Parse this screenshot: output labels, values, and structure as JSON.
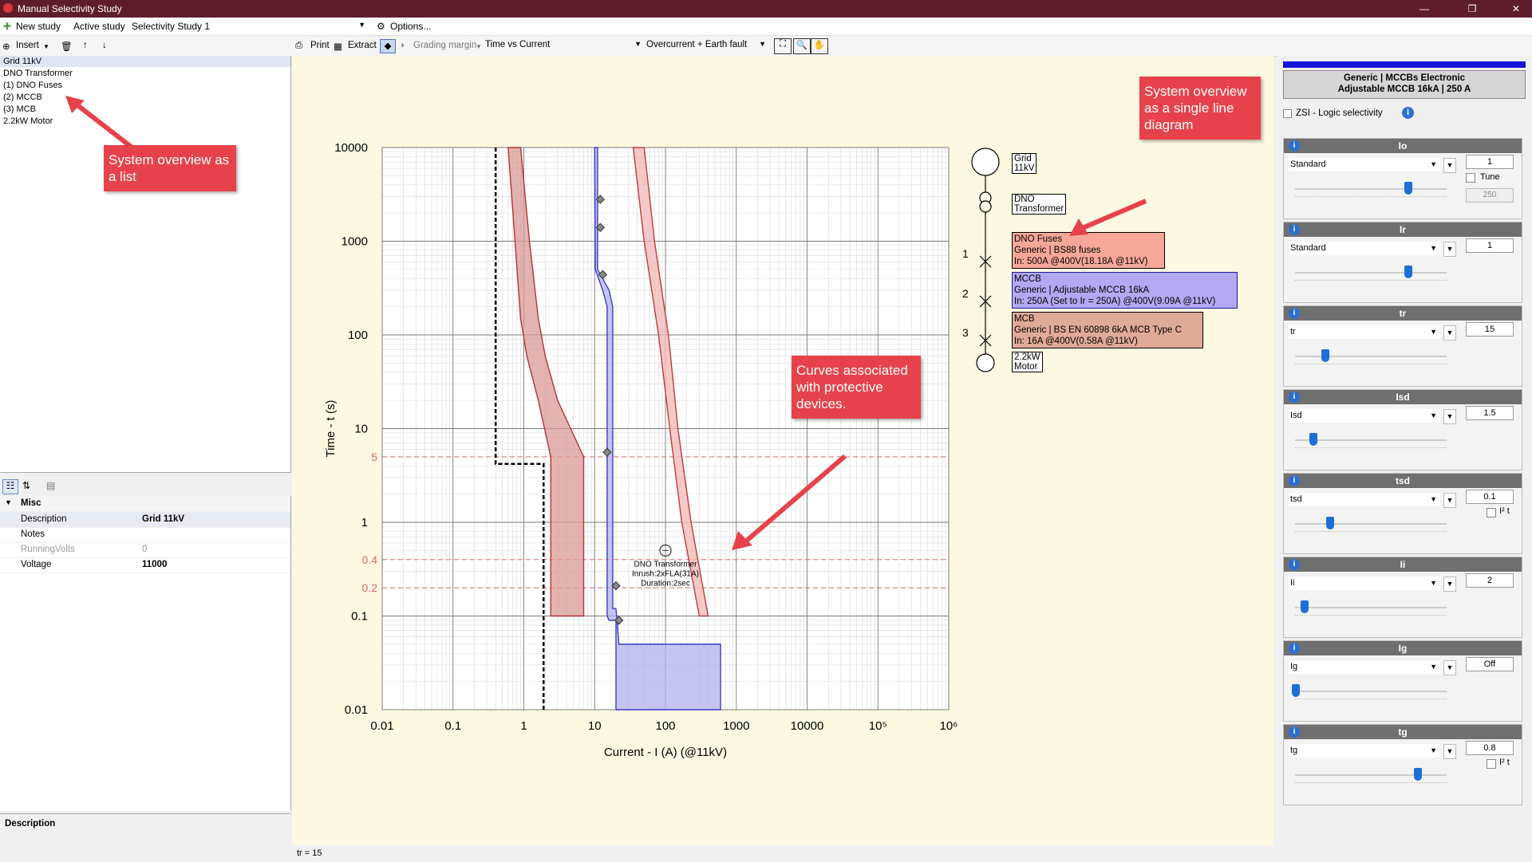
{
  "window": {
    "title": "Manual Selectivity Study",
    "minimize": "—",
    "maximize": "❐",
    "close": "✕"
  },
  "studybar": {
    "new_study": "New study",
    "active_study_label": "Active study",
    "active_study_value": "Selectivity Study 1",
    "options": "Options..."
  },
  "toolbar": {
    "insert": "Insert",
    "print": "Print",
    "extract": "Extract",
    "grading_margin": "Grading margin",
    "view_mode": "Time vs Current",
    "fault_mode": "Overcurrent + Earth fault"
  },
  "tree": {
    "items": [
      "Grid 11kV",
      "DNO Transformer",
      "(1) DNO Fuses",
      "(2) MCCB",
      "(3) MCB",
      "2.2kW Motor"
    ]
  },
  "properties": {
    "category": "Misc",
    "rows": [
      {
        "key": "Description",
        "value": "Grid 11kV",
        "bold": true
      },
      {
        "key": "Notes",
        "value": "",
        "bold": false
      },
      {
        "key": "RunningVolts",
        "value": "0",
        "bold": false,
        "grey": true
      },
      {
        "key": "Voltage",
        "value": "11000",
        "bold": true
      }
    ]
  },
  "description_panel": {
    "title": "Description"
  },
  "status": {
    "text": "tr = 15"
  },
  "callouts": {
    "list": "System overview as a list",
    "sld": "System overview as a single line diagram",
    "curves": "Curves associated with protective devices."
  },
  "sld": {
    "grid": "Grid 11kV",
    "transformer": "DNO Transformer",
    "motor": "2.2kW Motor",
    "devices": [
      {
        "num": "1",
        "lines": [
          "DNO Fuses",
          "Generic | BS88 fuses",
          "In: 500A @400V(18.18A @11kV)"
        ],
        "color": "#f6a799"
      },
      {
        "num": "2",
        "lines": [
          "MCCB",
          "Generic | Adjustable MCCB 16kA",
          "In: 250A (Set to Ir = 250A) @400V(9.09A @11kV)"
        ],
        "color": "#b3a8f2"
      },
      {
        "num": "3",
        "lines": [
          "MCB",
          "Generic | BS EN 60898 6kA MCB Type C",
          "In: 16A @400V(0.58A @11kV)"
        ],
        "color": "#e0aa98"
      }
    ]
  },
  "right_panel": {
    "device_title_1": "Generic | MCCBs Electronic",
    "device_title_2": "Adjustable MCCB 16kA | 250 A",
    "zsi": "ZSI - Logic selectivity",
    "sections": [
      {
        "name": "Io",
        "mode": "Standard",
        "value": "1",
        "pos": 0.76,
        "extra": "tune"
      },
      {
        "name": "Ir",
        "mode": "Standard",
        "value": "1",
        "pos": 0.76
      },
      {
        "name": "tr",
        "mode": "tr",
        "value": "15",
        "pos": 0.2
      },
      {
        "name": "Isd",
        "mode": "Isd",
        "value": "1.5",
        "pos": 0.12
      },
      {
        "name": "tsd",
        "mode": "tsd",
        "value": "0.1",
        "pos": 0.23,
        "extra": "i2t"
      },
      {
        "name": "Ii",
        "mode": "Ii",
        "value": "2",
        "pos": 0.06
      },
      {
        "name": "Ig",
        "mode": "Ig",
        "value": "Off",
        "pos": 0.0
      },
      {
        "name": "tg",
        "mode": "tg",
        "value": "0.8",
        "pos": 0.82,
        "extra": "i2t"
      }
    ],
    "tune_label": "Tune",
    "tune_value": "250",
    "i2t_label": "I² t"
  },
  "chart_data": {
    "type": "line",
    "xlabel": "Current - I (A)   (@11kV)",
    "ylabel": "Time - t (s)",
    "xscale": "log",
    "yscale": "log",
    "xlim": [
      0.01,
      1000000
    ],
    "ylim": [
      0.01,
      10000
    ],
    "x_ticks": [
      "0.01",
      "0.1",
      "1",
      "10",
      "100",
      "1000",
      "10000",
      "10⁵",
      "10⁶"
    ],
    "y_ticks": [
      "10000",
      "1000",
      "100",
      "10",
      "1",
      "0.1",
      "0.01"
    ],
    "margin_lines": [
      {
        "y": 5,
        "label": "5"
      },
      {
        "y": 0.4,
        "label": "0.4"
      },
      {
        "y": 0.2,
        "label": "0.2"
      }
    ],
    "grid": true,
    "annotation": {
      "x": 100,
      "y": 0.5,
      "lines": [
        "DNO Transformer",
        "Inrush:2xFLA(31A)",
        "Duration:2sec"
      ]
    },
    "series": [
      {
        "name": "DNO Fuses",
        "color": "#b53434",
        "fill": "#d89a96",
        "left": [
          [
            0.6,
            10000
          ],
          [
            0.75,
            1000
          ],
          [
            0.9,
            150
          ],
          [
            1.1,
            60
          ],
          [
            1.6,
            20
          ],
          [
            2.4,
            5
          ],
          [
            2.4,
            0.1
          ]
        ],
        "right": [
          [
            0.9,
            10000
          ],
          [
            1.2,
            1000
          ],
          [
            1.6,
            150
          ],
          [
            2.0,
            60
          ],
          [
            3.0,
            20
          ],
          [
            7.0,
            5
          ],
          [
            7.0,
            0.1
          ]
        ]
      },
      {
        "name": "MCCB",
        "color": "#3a3ad0",
        "fill": "#b2b2ee",
        "left": [
          [
            10,
            10000
          ],
          [
            10.2,
            500
          ],
          [
            13,
            300
          ],
          [
            15,
            200
          ],
          [
            15,
            0.1
          ],
          [
            16,
            0.09
          ],
          [
            20,
            0.09
          ],
          [
            20,
            0.01
          ]
        ],
        "right": [
          [
            11,
            10000
          ],
          [
            11,
            500
          ],
          [
            16,
            300
          ],
          [
            18,
            200
          ],
          [
            18,
            0.12
          ],
          [
            20,
            0.12
          ],
          [
            21,
            0.08
          ],
          [
            22,
            0.05
          ],
          [
            600,
            0.05
          ],
          [
            600,
            0.01
          ]
        ]
      },
      {
        "name": "MCB",
        "color": "#c03a3a",
        "fill": "#f2b7b7",
        "left": [
          [
            35,
            10000
          ],
          [
            50,
            1000
          ],
          [
            80,
            100
          ],
          [
            115,
            10
          ],
          [
            170,
            1
          ],
          [
            300,
            0.1
          ]
        ],
        "right": [
          [
            50,
            10000
          ],
          [
            70,
            1000
          ],
          [
            110,
            100
          ],
          [
            150,
            10
          ],
          [
            230,
            1
          ],
          [
            400,
            0.1
          ]
        ]
      }
    ],
    "grid_curve": {
      "name": "Grid 11kV",
      "color": "#000000",
      "points": [
        [
          0.4,
          10000
        ],
        [
          0.4,
          4.2
        ],
        [
          1.9,
          4.2
        ],
        [
          1.9,
          0.01
        ]
      ]
    },
    "markers": [
      [
        12,
        2800
      ],
      [
        12,
        1400
      ],
      [
        13,
        440
      ],
      [
        15,
        5.6
      ],
      [
        20,
        0.21
      ],
      [
        22,
        0.09
      ]
    ]
  }
}
